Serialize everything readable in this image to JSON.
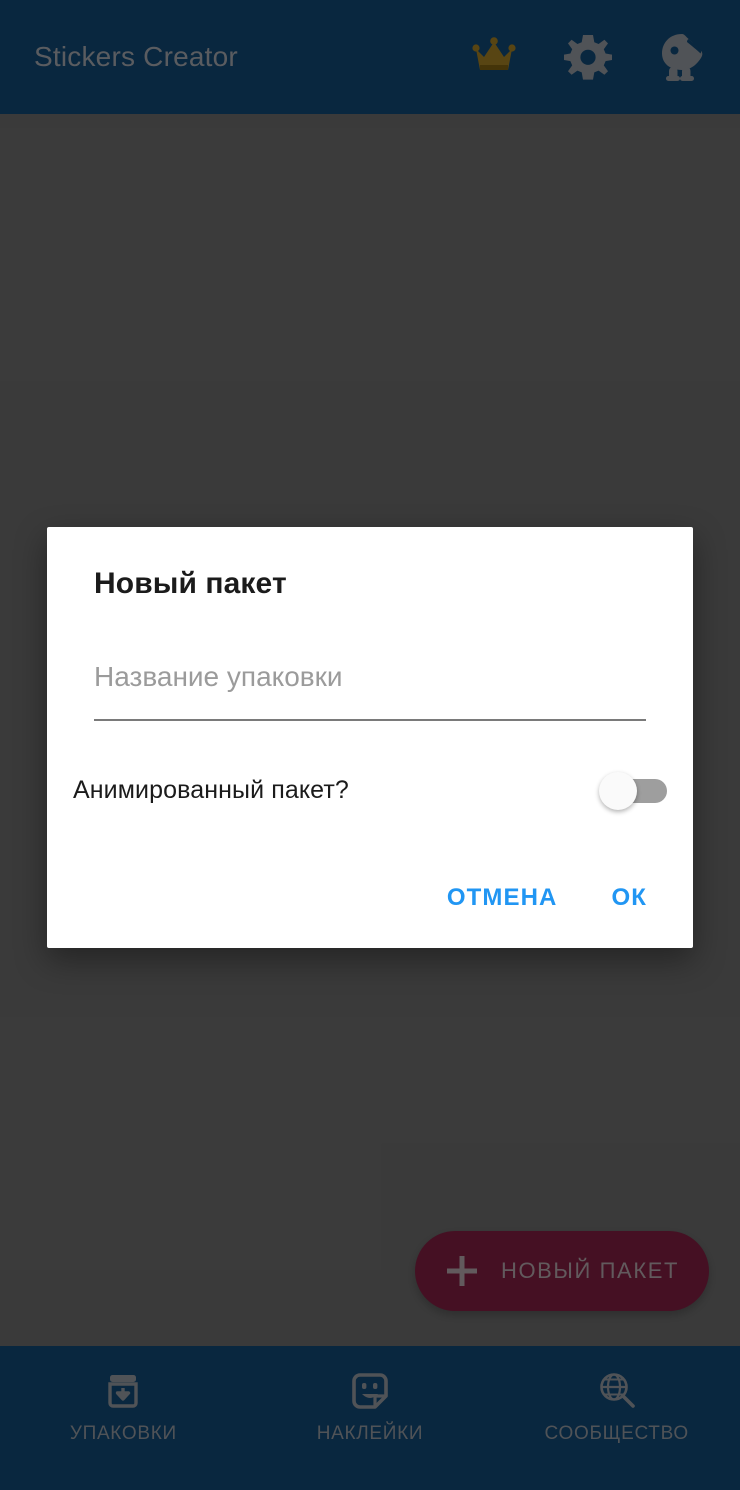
{
  "toolbar": {
    "title": "Stickers Creator",
    "actions": [
      {
        "name": "premium-crown-icon",
        "label": "Premium",
        "color": "#8a6d1f"
      },
      {
        "name": "settings-gear-icon",
        "label": "Settings",
        "color": "#7d8288"
      },
      {
        "name": "mascot-icon",
        "label": "Mascot",
        "color": "#7d8288"
      }
    ],
    "background": "#0f3d63"
  },
  "fab": {
    "label": "НОВЫЙ ПАКЕТ",
    "icon": "plus-icon",
    "background": "#6c1a37"
  },
  "bottom_nav": {
    "items": [
      {
        "label": "УПАКОВКИ",
        "icon": "archive-download-icon",
        "selected": true
      },
      {
        "label": "НАКЛЕЙКИ",
        "icon": "sticker-smiley-icon",
        "selected": false
      },
      {
        "label": "СООБЩЕСТВО",
        "icon": "globe-search-icon",
        "selected": false
      }
    ],
    "background": "#0f3d63"
  },
  "dialog": {
    "title": "Новый пакет",
    "input": {
      "value": "",
      "placeholder": "Название упаковки"
    },
    "animated": {
      "label": "Анимированный пакет?",
      "checked": false
    },
    "actions": {
      "cancel": "ОТМЕНА",
      "ok": "ОК"
    },
    "accent_color": "#2196f3"
  },
  "scrim": {
    "color": "#5c5c5c"
  }
}
